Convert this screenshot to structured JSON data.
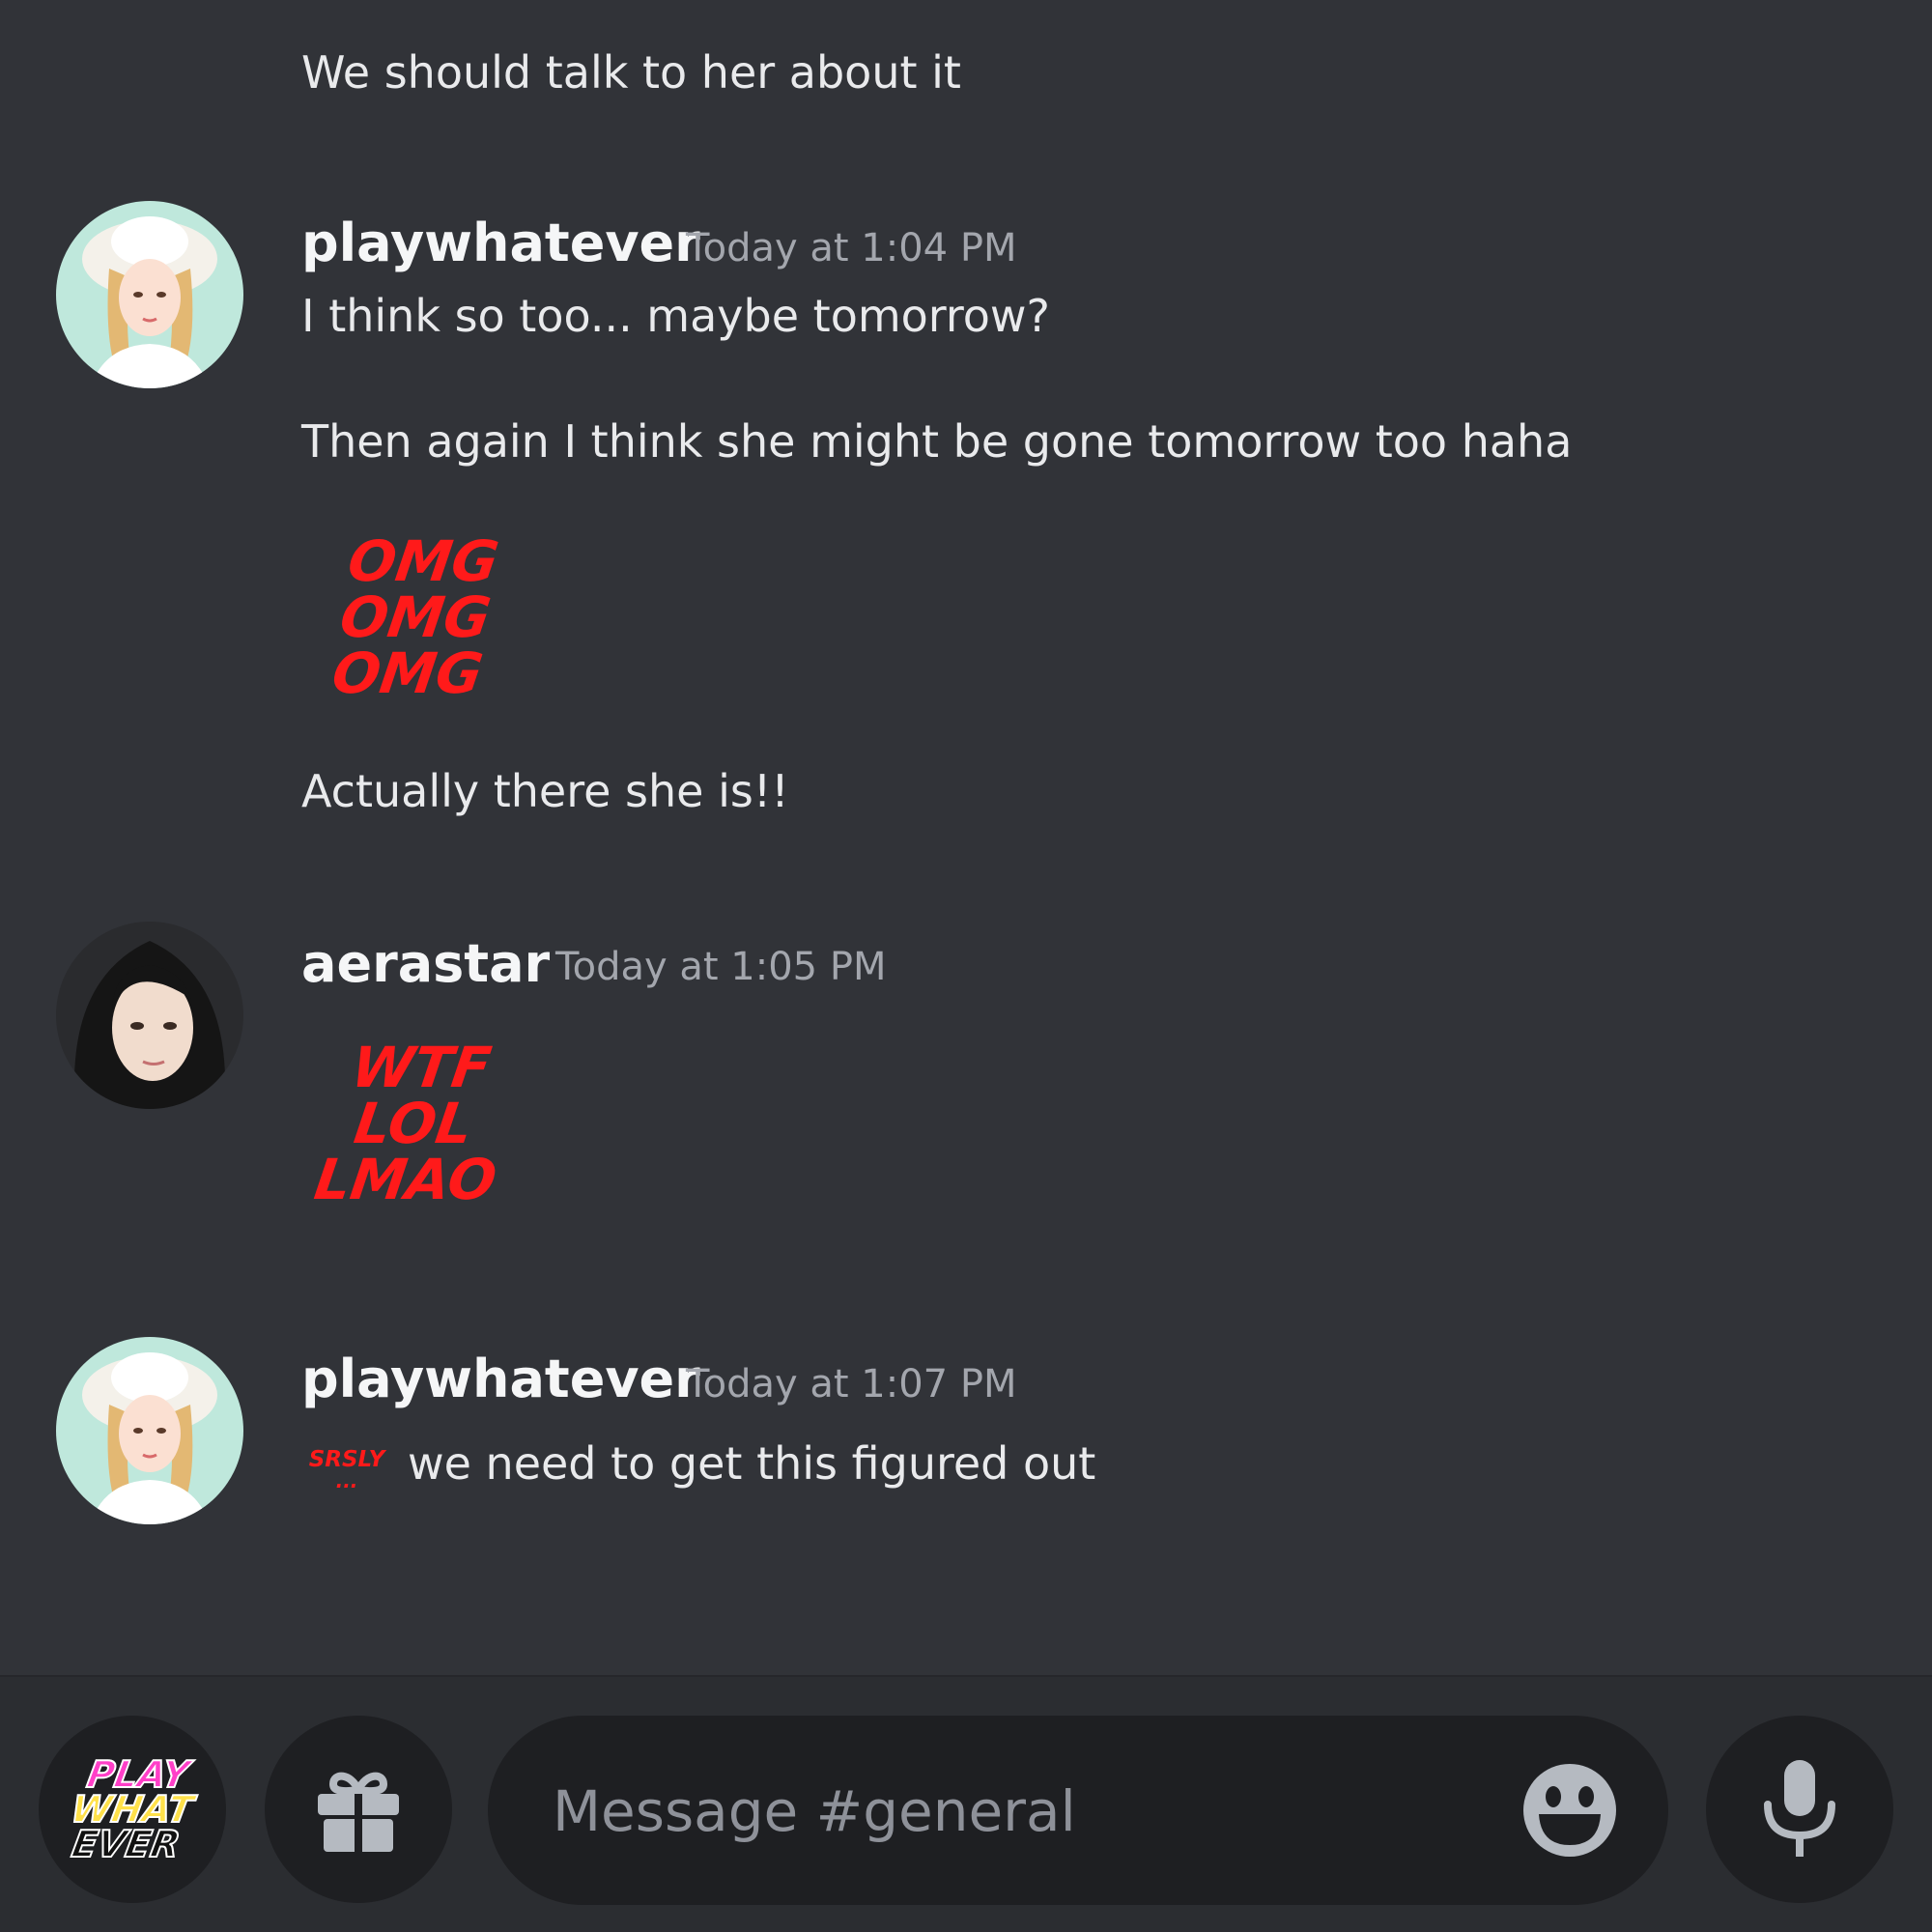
{
  "channel": {
    "name": "general",
    "composer_placeholder": "Message #general"
  },
  "colors": {
    "background": "#313338",
    "bottom_bar": "#2b2d31",
    "control": "#1e1f22",
    "sticker_red": "#ff1a1a",
    "timestamp": "#a3a6ad"
  },
  "messages": [
    {
      "text": "We should talk to her about it"
    },
    {
      "username": "playwhatever",
      "timestamp": "Today at 1:04 PM",
      "lines": [
        "I think so too... maybe tomorrow?",
        "Then again I think she might be gone tomorrow too haha"
      ],
      "sticker": {
        "lines": [
          "OMG",
          "OMG",
          "OMG"
        ]
      },
      "after": "Actually there she is!!"
    },
    {
      "username": "aerastar",
      "timestamp": "Today at 1:05 PM",
      "sticker": {
        "lines": [
          "WTF",
          "LOL",
          "LMAO"
        ]
      }
    },
    {
      "username": "playwhatever",
      "timestamp": "Today at 1:07 PM",
      "emoji": {
        "line1": "SRSLY",
        "line2": "..."
      },
      "text": "we need to get this figured out"
    }
  ],
  "toolbar": {
    "app_logo": {
      "line1": "PLAY",
      "line2": "WHAT",
      "line3": "EVER"
    },
    "icons": [
      "gift-icon",
      "emoji-icon",
      "microphone-icon"
    ]
  }
}
